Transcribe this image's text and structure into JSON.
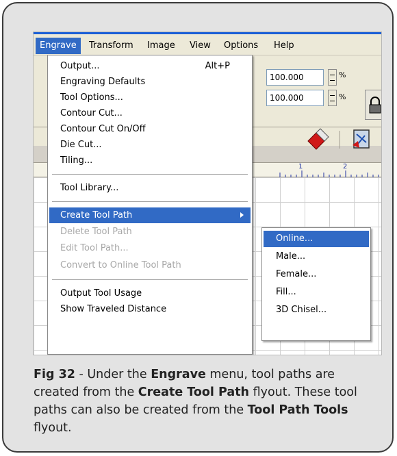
{
  "menubar": {
    "items": [
      "Engrave",
      "Transform",
      "Image",
      "View",
      "Options",
      "Help"
    ],
    "active": "Engrave"
  },
  "toolbar": {
    "scale_x": "100.000",
    "scale_y": "100.000",
    "percent": "%",
    "ruler_labels": [
      "1",
      "2"
    ]
  },
  "engrave_menu": {
    "group1": [
      {
        "label": "Output...",
        "shortcut": "Alt+P"
      },
      {
        "label": "Engraving Defaults"
      },
      {
        "label": "Tool Options..."
      },
      {
        "label": "Contour Cut..."
      },
      {
        "label": "Contour Cut On/Off"
      },
      {
        "label": "Die Cut..."
      },
      {
        "label": "Tiling..."
      }
    ],
    "group2": [
      {
        "label": "Tool Library..."
      }
    ],
    "group3": [
      {
        "label": "Create Tool Path",
        "state": "highlighted"
      },
      {
        "label": "Delete Tool Path",
        "state": "disabled"
      },
      {
        "label": "Edit Tool Path...",
        "state": "disabled"
      },
      {
        "label": "Convert to Online Tool Path",
        "state": "disabled"
      }
    ],
    "group4": [
      {
        "label": "Output Tool Usage"
      },
      {
        "label": "Show Traveled Distance"
      }
    ]
  },
  "flyout": {
    "items": [
      "Online...",
      "Male...",
      "Female...",
      "Fill...",
      "3D Chisel..."
    ],
    "highlighted": "Online..."
  },
  "caption": {
    "fig": "Fig 32",
    "t1": " - Under the ",
    "b1": "Engrave",
    "t2": " menu, tool paths are created from the ",
    "b2": "Create Tool Path",
    "t3": " flyout. These tool paths can also be created from the ",
    "b3": "Tool Path Tools",
    "t4": " flyout."
  },
  "colors": {
    "highlight": "#316ac5",
    "menubar_bg": "#ece9d8",
    "card_bg": "#e3e3e3",
    "card_border": "#3a3a3a"
  },
  "icons": [
    "lock-icon",
    "diamond-tool-icon",
    "engrave-tool-icon",
    "submenu-arrow-icon"
  ]
}
